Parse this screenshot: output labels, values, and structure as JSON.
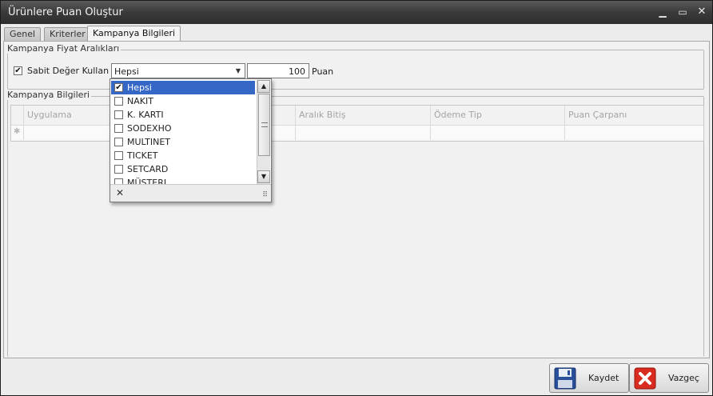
{
  "window": {
    "title": "Ürünlere Puan Oluştur"
  },
  "tabs": [
    {
      "label": "Genel"
    },
    {
      "label": "Kriterler"
    },
    {
      "label": "Kampanya Bilgileri"
    }
  ],
  "fiyat_group": {
    "label": "Kampanya Fiyat Aralıkları",
    "sabit_label": "Sabit Değer Kullan",
    "sabit_checked": true,
    "combo_value": "Hepsi",
    "point_value": "100",
    "point_unit": "Puan"
  },
  "bilgi_group": {
    "label": "Kampanya Bilgileri",
    "columns": [
      "Uygulama",
      "Aralık Bitiş",
      "Ödeme Tip",
      "Puan Çarpanı"
    ]
  },
  "dropdown": {
    "items": [
      {
        "label": "Hepsi",
        "checked": true
      },
      {
        "label": "NAKIT",
        "checked": false
      },
      {
        "label": "K. KARTI",
        "checked": false
      },
      {
        "label": "SODEXHO",
        "checked": false
      },
      {
        "label": "MULTINET",
        "checked": false
      },
      {
        "label": "TICKET",
        "checked": false
      },
      {
        "label": "SETCARD",
        "checked": false
      },
      {
        "label": "MÜŞTERI",
        "checked": false
      }
    ]
  },
  "buttons": {
    "save": "Kaydet",
    "cancel": "Vazgeç"
  },
  "colors": {
    "selection": "#3567c6",
    "title_bar": "#3a3a3a",
    "cancel_red": "#d92b1f"
  }
}
